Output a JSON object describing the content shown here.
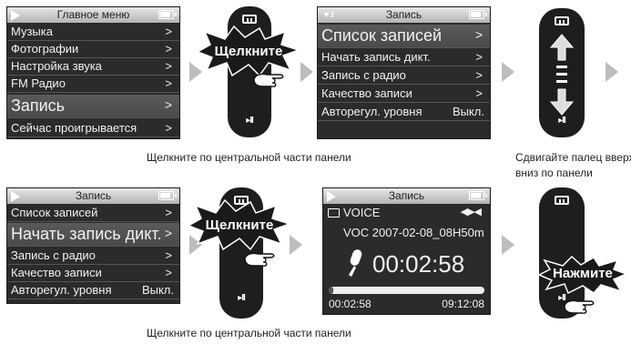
{
  "step1": {
    "title": "Главное меню",
    "items": [
      {
        "label": "Музыка",
        "arrow": ">"
      },
      {
        "label": "Фотографии",
        "arrow": ">"
      },
      {
        "label": "Настройка звука",
        "arrow": ">"
      },
      {
        "label": "FM Радио",
        "arrow": ">"
      },
      {
        "label": "Запись",
        "arrow": ">"
      },
      {
        "label": "Сейчас проигрывается",
        "arrow": ">"
      }
    ]
  },
  "step2": {
    "title": "Запись",
    "items": [
      {
        "label": "Список записей",
        "arrow": ">"
      },
      {
        "label": "Начать запись дикт.",
        "arrow": ">"
      },
      {
        "label": "Запись с радио",
        "arrow": ">"
      },
      {
        "label": "Качество записи",
        "arrow": ">"
      },
      {
        "label": "Авторегул. уровня",
        "value": "Выкл."
      }
    ]
  },
  "step3": {
    "title": "Запись",
    "items": [
      {
        "label": "Список записей",
        "arrow": ">"
      },
      {
        "label": "Начать запись дикт.",
        "arrow": ">"
      },
      {
        "label": "Запись с радио",
        "arrow": ">"
      },
      {
        "label": "Качество записи",
        "arrow": ">"
      },
      {
        "label": "Авторегул. уровня",
        "value": "Выкл."
      }
    ]
  },
  "step4": {
    "title": "Запись",
    "folder": "VOICE",
    "filename": "VOC 2007-02-08_08H50m",
    "timer": "00:02:58",
    "elapsed": "00:02:58",
    "remaining": "09:12:08",
    "progress_percent": 3
  },
  "device": {
    "click_label": "Щелкните",
    "press_label": "Нажмите",
    "play_pause_icon": "▸II"
  },
  "captions": {
    "top_center": "Щелкните по центральной части панели",
    "top_right_line1": "Сдвигайте палец вверх/",
    "top_right_line2": "вниз по панели",
    "bottom_center": "Щелкните по центральной части панели"
  },
  "colors": {
    "screen_bg": "#2b2b2b",
    "highlight_bg": "#555555",
    "device_bg": "#1e1e1e",
    "arrow_grey": "#bdbdbd"
  }
}
